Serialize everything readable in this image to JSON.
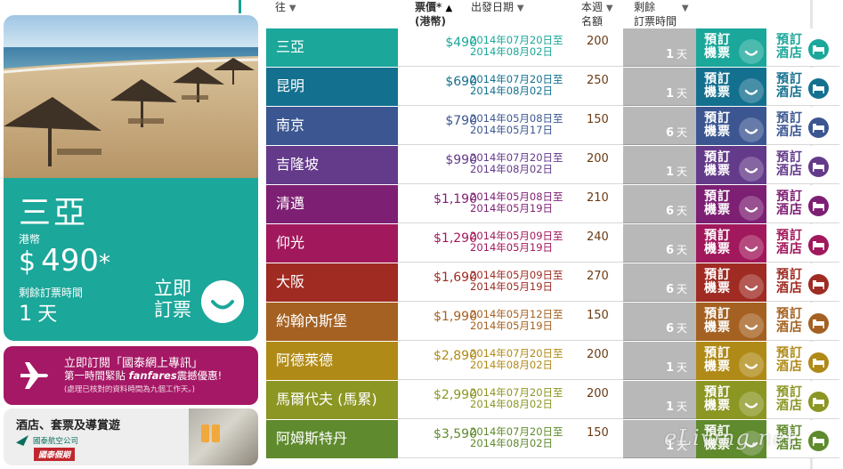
{
  "featured": {
    "city": "三亞",
    "currency": "港幣",
    "currency_symbol": "$",
    "price": "490",
    "price_suffix": "*",
    "remaining_label": "剩餘訂票時間",
    "remaining_value": "1",
    "remaining_unit": "天",
    "book_label_line1": "立即",
    "book_label_line2": "訂票",
    "accent_color": "#1ba79a"
  },
  "promo": {
    "line1": "立即訂閱「國泰網上專訊」",
    "line2_pre": "第一時間緊貼 ",
    "line2_brand": "fanfares",
    "line2_post": "震撼優惠!",
    "line3": "(處理已核對的資料時間為九個工作天。)",
    "color": "#a51865"
  },
  "hotel_box": {
    "title": "酒店、套票及導賞遊",
    "airline_name": "國泰航空公司",
    "holidays_label": "國泰假期"
  },
  "columns": {
    "dest": "往",
    "price_line1": "票價*",
    "price_line2": "(港幣)",
    "dates": "出發日期",
    "quota_line1": "本週",
    "quota_line2": "名額",
    "remain_line1": "剩餘",
    "remain_line2": "訂票時間"
  },
  "row_labels": {
    "book_line1": "預訂",
    "book_line2": "機票",
    "hotel_line1": "預訂",
    "hotel_line2": "酒店",
    "day_unit": "天"
  },
  "rows": [
    {
      "city": "三亞",
      "price": "$490",
      "date_from": "2014年07月20日至",
      "date_to": "2014年08月02日",
      "quota": "200",
      "remaining": "1",
      "color": "#1ba79a"
    },
    {
      "city": "昆明",
      "price": "$690",
      "date_from": "2014年07月20日至",
      "date_to": "2014年08月02日",
      "quota": "250",
      "remaining": "1",
      "color": "#14708f"
    },
    {
      "city": "南京",
      "price": "$790",
      "date_from": "2014年05月08日至",
      "date_to": "2014年05月17日",
      "quota": "150",
      "remaining": "6",
      "color": "#3b5691"
    },
    {
      "city": "吉隆坡",
      "price": "$990",
      "date_from": "2014年07月20日至",
      "date_to": "2014年08月02日",
      "quota": "200",
      "remaining": "1",
      "color": "#643a8a"
    },
    {
      "city": "清邁",
      "price": "$1,190",
      "date_from": "2014年05月08日至",
      "date_to": "2014年05月19日",
      "quota": "210",
      "remaining": "6",
      "color": "#7d1f73"
    },
    {
      "city": "仰光",
      "price": "$1,290",
      "date_from": "2014年05月09日至",
      "date_to": "2014年05月19日",
      "quota": "240",
      "remaining": "6",
      "color": "#a2185c"
    },
    {
      "city": "大阪",
      "price": "$1,690",
      "date_from": "2014年05月09日至",
      "date_to": "2014年05月19日",
      "quota": "270",
      "remaining": "6",
      "color": "#9f2b23"
    },
    {
      "city": "約翰內斯堡",
      "price": "$1,990",
      "date_from": "2014年05月12日至",
      "date_to": "2014年05月19日",
      "quota": "150",
      "remaining": "6",
      "color": "#a46121"
    },
    {
      "city": "阿德萊德",
      "price": "$2,890",
      "date_from": "2014年07月20日至",
      "date_to": "2014年08月02日",
      "quota": "200",
      "remaining": "1",
      "color": "#b08a17"
    },
    {
      "city": "馬爾代夫 (馬累)",
      "price": "$2,990",
      "date_from": "2014年07月20日至",
      "date_to": "2014年08月02日",
      "quota": "200",
      "remaining": "1",
      "color": "#8c9623"
    },
    {
      "city": "阿姆斯特丹",
      "price": "$3,590",
      "date_from": "2014年07月20日至",
      "date_to": "2014年08月02日",
      "quota": "150",
      "remaining": "1",
      "color": "#5f8a2d"
    }
  ],
  "watermark": "eLiving.net"
}
